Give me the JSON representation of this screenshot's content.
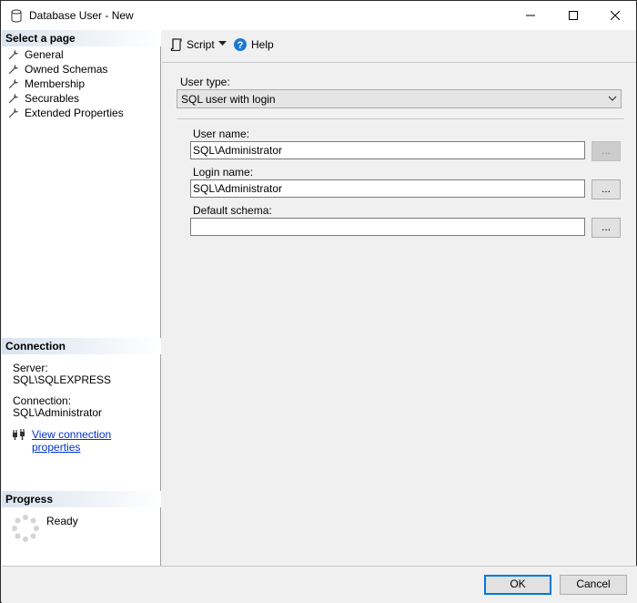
{
  "window": {
    "title": "Database User - New",
    "icon": "database-icon"
  },
  "left": {
    "select_page_header": "Select a page",
    "pages": [
      {
        "label": "General",
        "icon": "wrench-icon"
      },
      {
        "label": "Owned Schemas",
        "icon": "wrench-icon"
      },
      {
        "label": "Membership",
        "icon": "wrench-icon"
      },
      {
        "label": "Securables",
        "icon": "wrench-icon"
      },
      {
        "label": "Extended Properties",
        "icon": "wrench-icon"
      }
    ],
    "connection_header": "Connection",
    "server_label": "Server:",
    "server_value": "SQL\\SQLEXPRESS",
    "connection_label": "Connection:",
    "connection_value": "SQL\\Administrator",
    "view_connection_link": "View connection properties",
    "progress_header": "Progress",
    "progress_status": "Ready"
  },
  "toolbar": {
    "script_label": "Script",
    "help_label": "Help"
  },
  "form": {
    "user_type_label": "User type:",
    "user_type_value": "SQL user with login",
    "user_name_label": "User name:",
    "user_name_value": "SQL\\Administrator",
    "login_name_label": "Login name:",
    "login_name_value": "SQL\\Administrator",
    "default_schema_label": "Default schema:",
    "default_schema_value": "",
    "browse_label": "..."
  },
  "footer": {
    "ok_label": "OK",
    "cancel_label": "Cancel"
  },
  "colors": {
    "accent": "#0078d7",
    "link": "#0033cc",
    "section_header": "#d9e3ef"
  }
}
